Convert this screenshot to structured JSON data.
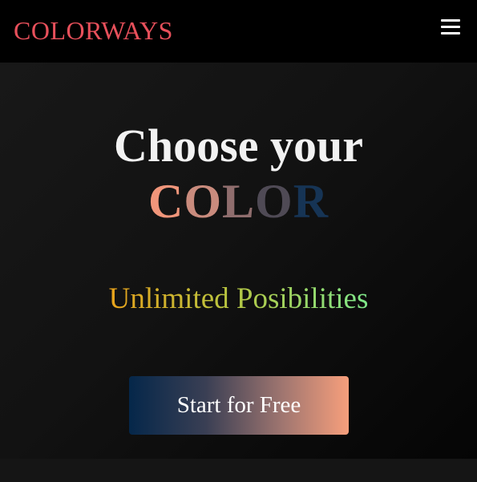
{
  "header": {
    "brand": "COLORWAYS",
    "brand_color": "#e8505b",
    "menu_icon": "hamburger-menu-icon"
  },
  "hero": {
    "headline": "Choose your",
    "color_word": {
      "letters": [
        {
          "char": "C",
          "color": "#f0957a"
        },
        {
          "char": "O",
          "color": "#c98b7d"
        },
        {
          "char": "L",
          "color": "#8f6d6d"
        },
        {
          "char": "O",
          "color": "#4f4a55"
        },
        {
          "char": "R",
          "color": "#163455"
        }
      ]
    },
    "tagline": "Unlimited Posibilities",
    "cta_label": "Start for Free"
  },
  "colors": {
    "topbar_bg": "#000000",
    "hero_bg": "#151515",
    "tagline_gradient": [
      "#e8a21b",
      "#b9c43f",
      "#7fe88a"
    ],
    "cta_gradient": [
      "#05274a",
      "#a07670",
      "#f79f7c"
    ]
  }
}
